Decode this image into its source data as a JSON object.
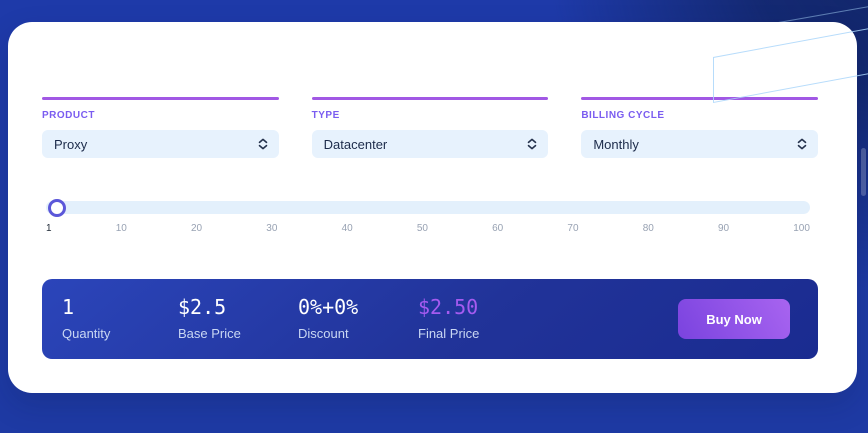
{
  "form": {
    "fields": [
      {
        "label": "PRODUCT",
        "value": "Proxy"
      },
      {
        "label": "TYPE",
        "value": "Datacenter"
      },
      {
        "label": "BILLING CYCLE",
        "value": "Monthly"
      }
    ]
  },
  "slider": {
    "value": "1",
    "ticks": [
      "1",
      "10",
      "20",
      "30",
      "40",
      "50",
      "60",
      "70",
      "80",
      "90",
      "100"
    ]
  },
  "summary": {
    "items": [
      {
        "value": "1",
        "label": "Quantity"
      },
      {
        "value": "$2.5",
        "label": "Base Price"
      },
      {
        "value": "0%+0%",
        "label": "Discount"
      },
      {
        "value": "$2.50",
        "label": "Final Price"
      }
    ],
    "buy_button_label": "Buy Now"
  },
  "colors": {
    "background_blue": "#1e3aa8",
    "background_dark_corner": "#122669",
    "accent_line_purple": "#a158e4",
    "field_label_purple": "#7a5cf0",
    "select_background": "#e7f2fd",
    "slider_track": "#e3f0fc",
    "slider_handle_ring": "#5b57d9",
    "summary_gradient_start": "#2b45ba",
    "summary_gradient_end": "#1a2b90",
    "final_price_purple": "#a55bf0",
    "buy_button_gradient_start": "#7a43df",
    "buy_button_gradient_end": "#a864f0"
  }
}
